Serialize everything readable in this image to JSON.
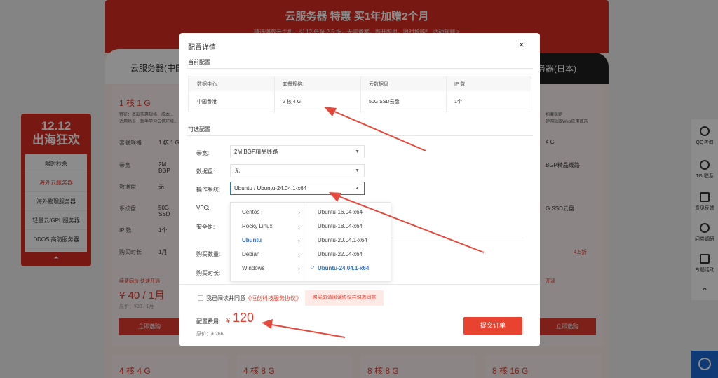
{
  "background": {
    "banner_title": "云服务器 特惠 买1年加赠2个月",
    "banner_sub": "精选爆款云主机，买 12 低至 2.5 折，无需备案，即开即用，限时抢购！ 活动规则 >",
    "tab_left": "云服务器(中国",
    "tab_right": "务器(日本)",
    "left_card": {
      "title": "1 核 1 G",
      "desc1": "特征：基础实惠规格，成本...",
      "desc2": "适用场景：新手学习云搭环境...",
      "rows": [
        {
          "label": "套餐规格",
          "value": "1 核 1 G"
        },
        {
          "label": "带宽",
          "value": "2M BGP"
        },
        {
          "label": "数据盘",
          "value": "无"
        },
        {
          "label": "系统盘",
          "value": "50G SSD"
        },
        {
          "label": "IP 数",
          "value": "1个"
        },
        {
          "label": "购买时长",
          "value": "1月"
        }
      ],
      "badges": "续费同价  快速开通",
      "price": "¥ 40 / 1月",
      "orig": "原价：¥88 / 1月",
      "button": "立即选购"
    },
    "right_card": {
      "desc1": "均衡稳定",
      "desc2": "建网站或Web应用首选",
      "rows": [
        "4 G",
        "BGP精品线路",
        "G SSD云盘"
      ],
      "discount": "4.5折",
      "badge": "开通",
      "button": "立即选购"
    },
    "bottom_cards": [
      "4 核 4 G",
      "4 核 8 G",
      "8 核 8 G",
      "8 核 16 G"
    ],
    "promo": {
      "title_line1": "12.12",
      "title_line2": "出海狂欢",
      "items": [
        "限时秒杀",
        "海外云服务器",
        "海外物理服务器",
        "轻量云/GPU服务器",
        "DDOS 高防服务器"
      ],
      "active_index": 1,
      "up_arrow": "⏶"
    },
    "sidebar": [
      "QQ咨询",
      "TG 联系",
      "意见反馈",
      "问卷调研",
      "专题活动"
    ],
    "sidebar_up": "⌃"
  },
  "modal": {
    "title": "配置详情",
    "close": "×",
    "current_section": "当前配置",
    "current_table": {
      "headers": [
        "数据中心:",
        "套餐规格:",
        "云数据盘",
        "IP 数"
      ],
      "values": [
        "中国香港",
        "2 核 4 G",
        "50G SSD云盘",
        "1个"
      ]
    },
    "optional_section": "可选配置",
    "options": {
      "bandwidth_label": "带宽:",
      "bandwidth_value": "2M BGP精品线路",
      "disk_label": "数据盘:",
      "disk_value": "无",
      "os_label": "操作系统:",
      "os_value": "Ubuntu / Ubuntu-24.04.1-x64",
      "vpc_label": "VPC:",
      "security_label": "安全组:",
      "quantity_label": "购买数量:",
      "duration_label": "购买时长:"
    },
    "os_dropdown": {
      "families": [
        "Centos",
        "Rocky Linux",
        "Ubuntu",
        "Debian",
        "Windows"
      ],
      "selected_family": "Ubuntu",
      "versions": [
        "Ubuntu-16.04-x64",
        "Ubuntu-18.04-x64",
        "Ubuntu-20.04.1-x64",
        "Ubuntu-22.04-x64",
        "Ubuntu-24.04.1-x64"
      ],
      "selected_version": "Ubuntu-24.04.1-x64",
      "check": "✓",
      "arrow": "›"
    },
    "agreement": {
      "prefix": "我已阅读并同意",
      "link": "《恒创科技服务协议》",
      "tip": "购买前请阅读协议并勾选同意"
    },
    "fee": {
      "label": "配置费用:",
      "currency": "¥",
      "value": "120",
      "orig": "原价：¥ 266"
    },
    "submit": "提交订单"
  },
  "colors": {
    "brand_red": "#e33b2e",
    "banner_red": "#d92c22",
    "link_blue": "#2f6fd0",
    "annotation_arrow": "#e8473b"
  }
}
